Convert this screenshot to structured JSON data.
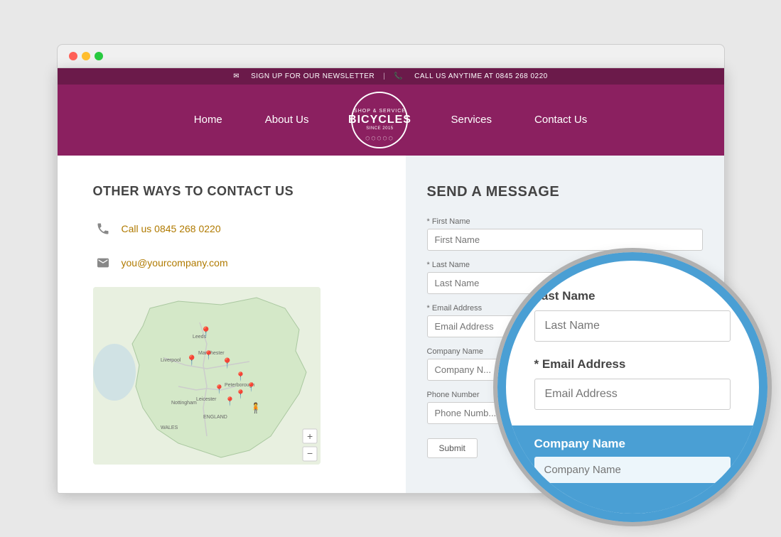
{
  "browser": {
    "dots": [
      "red",
      "yellow",
      "green"
    ]
  },
  "topBar": {
    "newsletter_text": "SIGN UP FOR OUR NEWSLETTER",
    "divider": "|",
    "call_text": "CALL US ANYTIME AT 0845 268 0220",
    "email_icon": "✉",
    "phone_icon": "📞"
  },
  "nav": {
    "items": [
      {
        "label": "Home",
        "id": "home"
      },
      {
        "label": "About Us",
        "id": "about"
      },
      {
        "label": "Services",
        "id": "services"
      },
      {
        "label": "Contact Us",
        "id": "contact"
      }
    ],
    "logo": {
      "top": "SHOP & SERVICE",
      "main": "BICYCLES",
      "bottom": "SINCE 2015"
    }
  },
  "leftPanel": {
    "heading": "OTHER WAYS TO CONTACT US",
    "phone": {
      "icon": "📞",
      "text": "Call us 0845 268 0220"
    },
    "email": {
      "icon": "✉",
      "text": "you@yourcompany.com"
    }
  },
  "rightPanel": {
    "heading": "SEND A MESSAGE",
    "form": {
      "firstName": {
        "label": "* First Name",
        "placeholder": "First Name"
      },
      "lastName": {
        "label": "* Last Name",
        "placeholder": "Last Name"
      },
      "email": {
        "label": "* Email Address",
        "placeholder": "Email Address"
      },
      "company": {
        "label": "Company Name",
        "placeholder": "Company N..."
      },
      "phone": {
        "label": "Phone Number",
        "placeholder": "Phone Numb..."
      },
      "submitLabel": "Submit"
    }
  },
  "magnifier": {
    "lastNameLabel": "Last Name",
    "lastNamePlaceholder": "Last Name",
    "emailLabel": "* Email Address",
    "emailPlaceholder": "Email Address",
    "companyLabel": "Company Name",
    "companyPlaceholder": "Company Name"
  }
}
